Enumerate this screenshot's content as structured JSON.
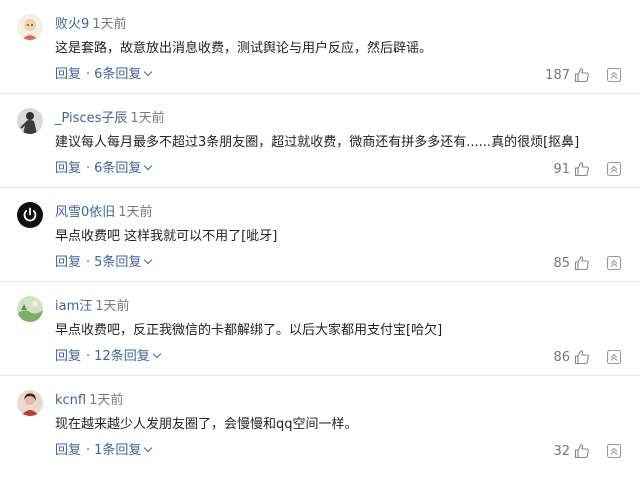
{
  "comments": [
    {
      "username": "败火9",
      "time": "1天前",
      "content": "这是套路，故意放出消息收费，测试舆论与用户反应，然后辟谣。",
      "reply_label": "回复",
      "replies_label": "6条回复",
      "likes": "187",
      "avatar_icon": "cartoon-avatar-icon"
    },
    {
      "username": "_Pisces子辰",
      "time": "1天前",
      "content": "建议每人每月最多不超过3条朋友圈，超过就收费，微商还有拼多多还有......真的很烦[抠鼻]",
      "reply_label": "回复",
      "replies_label": "6条回复",
      "likes": "91",
      "avatar_icon": "figure-avatar-icon"
    },
    {
      "username": "风雪0依旧",
      "time": "1天前",
      "content": "早点收费吧 这样我就可以不用了[呲牙]",
      "reply_label": "回复",
      "replies_label": "5条回复",
      "likes": "85",
      "avatar_icon": "power-avatar-icon"
    },
    {
      "username": "iam汪",
      "time": "1天前",
      "content": "早点收费吧，反正我微信的卡都解绑了。以后大家都用支付宝[哈欠]",
      "reply_label": "回复",
      "replies_label": "12条回复",
      "likes": "86",
      "avatar_icon": "landscape-avatar-icon"
    },
    {
      "username": "kcnfl",
      "time": "1天前",
      "content": "现在越来越少人发朋友圈了，会慢慢和qq空间一样。",
      "reply_label": "回复",
      "replies_label": "1条回复",
      "likes": "32",
      "avatar_icon": "person-avatar-icon"
    }
  ],
  "colors": {
    "link": "#406599",
    "text": "#222222",
    "muted": "#7a7a7a",
    "divider": "#e6e6e6"
  }
}
